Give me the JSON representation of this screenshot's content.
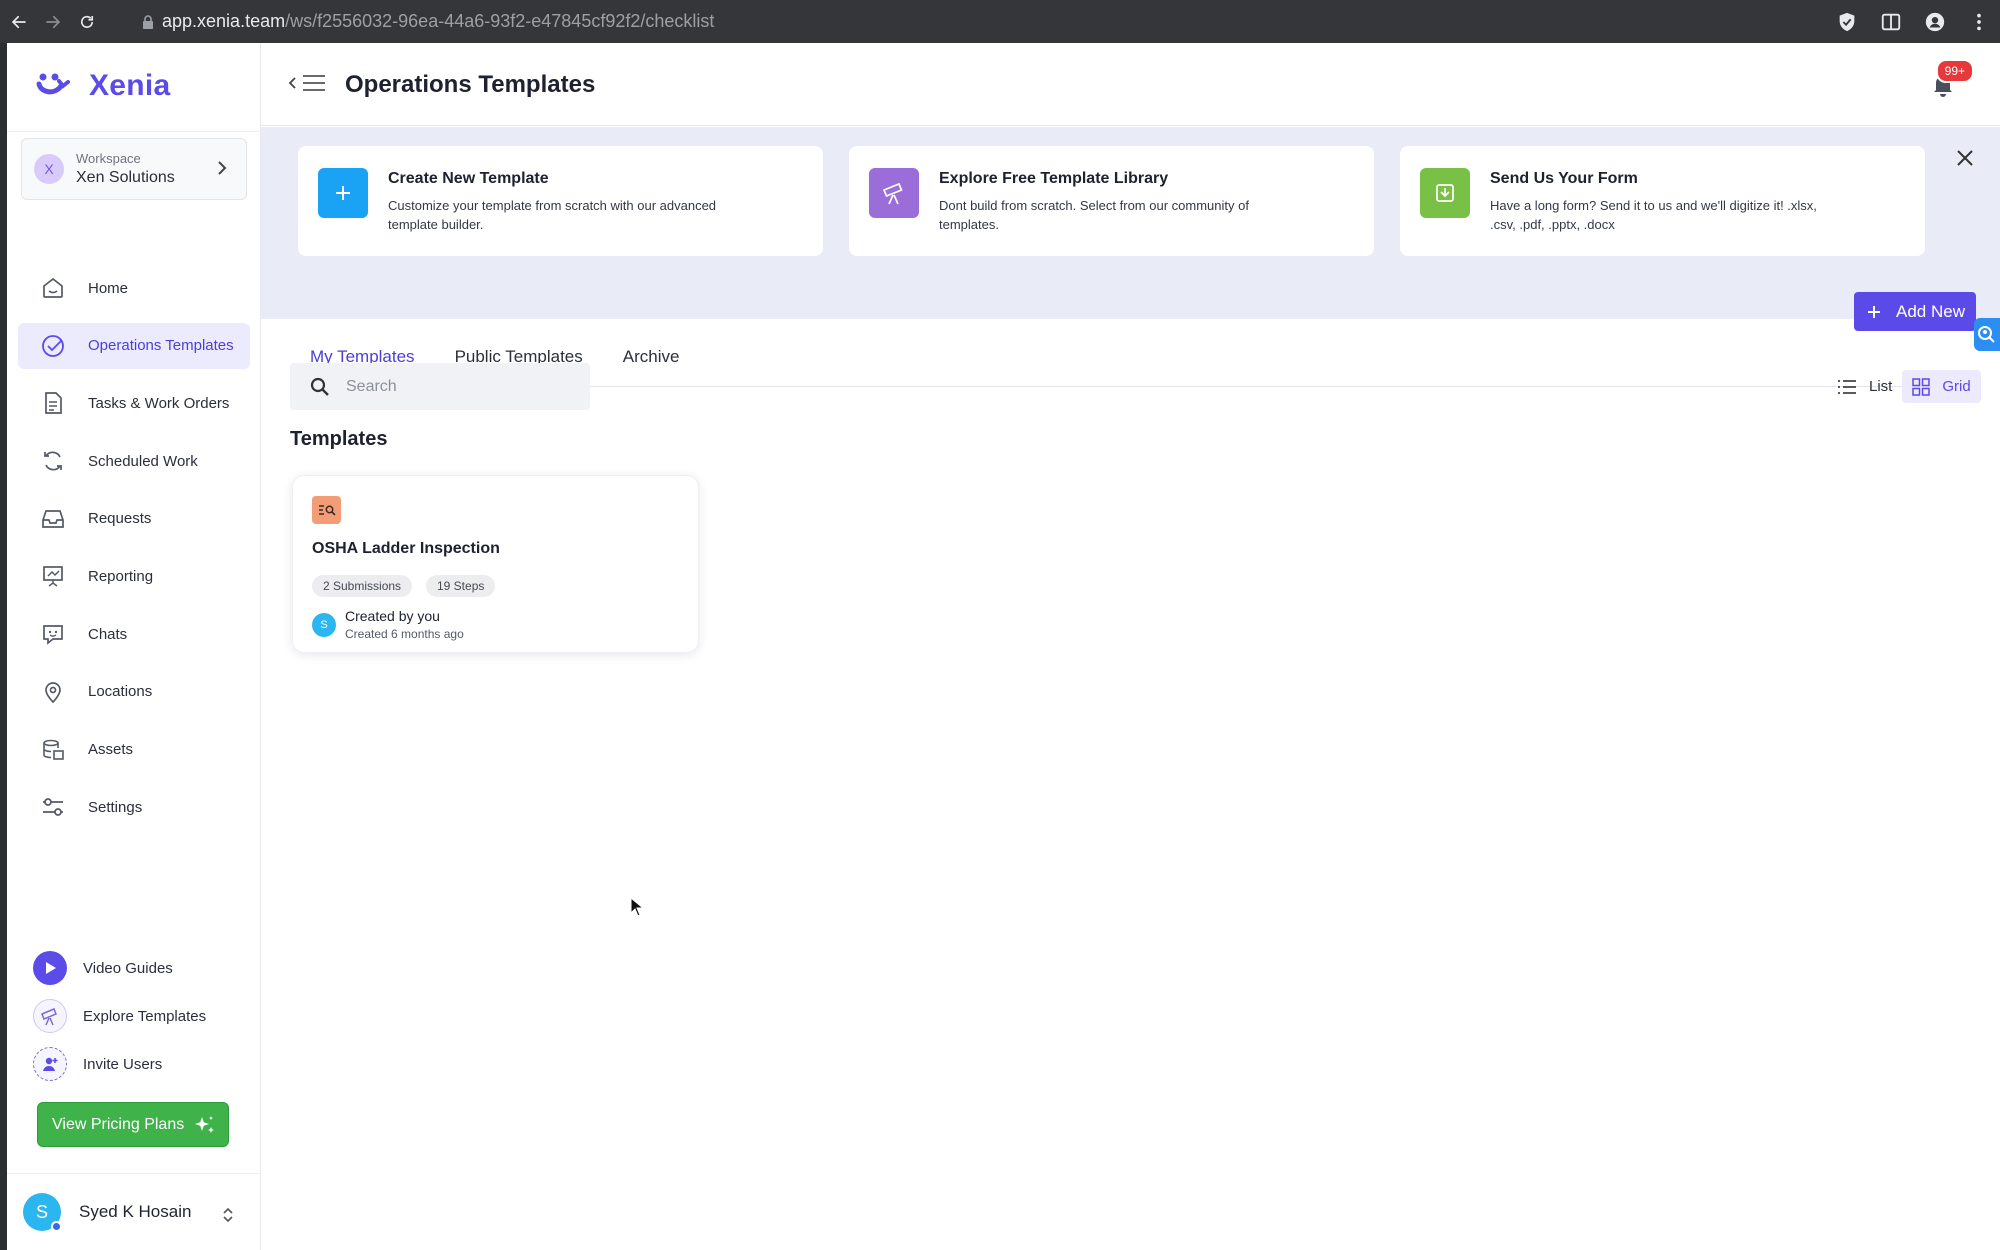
{
  "browser": {
    "url_host": "app.xenia.team",
    "url_path": "/ws/f2556032-96ea-44a6-93f2-e47845cf92f2/checklist"
  },
  "brand": {
    "name": "Xenia",
    "color": "#5b4be8"
  },
  "workspace": {
    "label": "Workspace",
    "name": "Xen Solutions",
    "avatar_letter": "X"
  },
  "sidebar": {
    "items": [
      {
        "label": "Home",
        "icon": "home-icon"
      },
      {
        "label": "Operations Templates",
        "icon": "check-circle-icon",
        "active": true
      },
      {
        "label": "Tasks & Work Orders",
        "icon": "document-icon"
      },
      {
        "label": "Scheduled Work",
        "icon": "refresh-icon"
      },
      {
        "label": "Requests",
        "icon": "inbox-icon"
      },
      {
        "label": "Reporting",
        "icon": "presentation-icon"
      },
      {
        "label": "Chats",
        "icon": "chat-icon"
      },
      {
        "label": "Locations",
        "icon": "map-pin-icon"
      },
      {
        "label": "Assets",
        "icon": "database-icon"
      },
      {
        "label": "Settings",
        "icon": "sliders-icon"
      }
    ],
    "bottom_links": [
      {
        "label": "Video Guides",
        "icon": "play-icon"
      },
      {
        "label": "Explore Templates",
        "icon": "telescope-icon"
      },
      {
        "label": "Invite Users",
        "icon": "user-plus-icon"
      }
    ],
    "pricing_button": "View Pricing Plans"
  },
  "user": {
    "name": "Syed K Hosain",
    "avatar_letter": "S"
  },
  "header": {
    "title": "Operations Templates",
    "notifications_badge": "99+"
  },
  "promo_cards": [
    {
      "title": "Create New Template",
      "description": "Customize your template from scratch with our advanced template builder.",
      "icon": "plus-icon",
      "color": "#1aa3f5"
    },
    {
      "title": "Explore Free Template Library",
      "description": "Dont build from scratch. Select from our community of templates.",
      "icon": "telescope-icon",
      "color": "#9b6dd8"
    },
    {
      "title": "Send Us Your Form",
      "description": "Have a long form? Send it to us and we'll digitize it! .xlsx, .csv, .pdf, .pptx, .docx",
      "icon": "download-icon",
      "color": "#78c046"
    }
  ],
  "tabs": [
    {
      "label": "My Templates",
      "active": true
    },
    {
      "label": "Public Templates"
    },
    {
      "label": "Archive"
    }
  ],
  "add_new_label": "Add New",
  "search": {
    "placeholder": "Search",
    "value": ""
  },
  "view_toggle": {
    "list_label": "List",
    "grid_label": "Grid",
    "selected": "Grid"
  },
  "section_title": "Templates",
  "templates": [
    {
      "name": "OSHA Ladder Inspection",
      "submissions": "2 Submissions",
      "steps": "19 Steps",
      "owner": "Created by you",
      "created": "Created 6 months ago",
      "owner_letter": "S"
    }
  ]
}
